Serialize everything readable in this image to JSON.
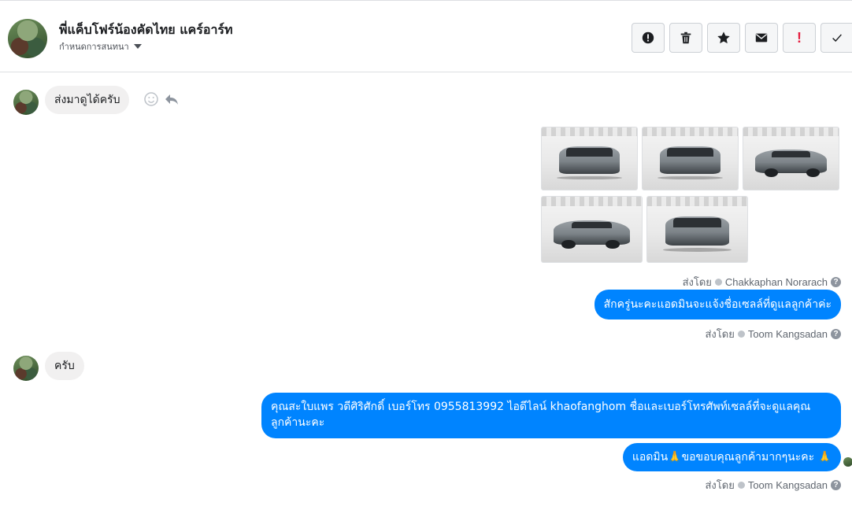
{
  "header": {
    "title": "พี่แค็บโฟร์น้องคัดไทย แคร์อาร์ท",
    "subtitle": "กำหนดการสนทนา",
    "actions": [
      "report-icon",
      "trash-icon",
      "star-icon",
      "envelope-icon",
      "exclamation-icon",
      "check-icon"
    ],
    "exclamation_label": "!"
  },
  "messages": {
    "m1": {
      "text": "ส่งมาดูได้ครับ"
    },
    "photos_count": 5,
    "meta1": {
      "prefix": "ส่งโดย",
      "name": "Chakkaphan Norarach",
      "help": "?"
    },
    "m2": {
      "text": "สักครู่นะคะแอดมินจะแจ้งชื่อเซลล์ที่ดูแลลูกค้าค่ะ"
    },
    "meta2": {
      "prefix": "ส่งโดย",
      "name": "Toom Kangsadan",
      "help": "?"
    },
    "m3": {
      "text": "ครับ"
    },
    "m4": {
      "text": "คุณสะใบแพร วดีศิริศักดิ์ เบอร์โทร 0955813992  ไอดีไลน์  khaofanghom  ชื่อและเบอร์โทรศัพท์เซลล์ที่จะดูแลคุณลูกค้านะคะ"
    },
    "m5": {
      "text": "แอดมิน🙏ขอขอบคุณลูกค้ามากๆนะคะ 🙏"
    },
    "meta3": {
      "prefix": "ส่งโดย",
      "name": "Toom Kangsadan",
      "help": "?"
    }
  },
  "colors": {
    "outgoing": "#0084ff",
    "incoming": "#f1f0f0",
    "alert": "#e41e3f"
  }
}
